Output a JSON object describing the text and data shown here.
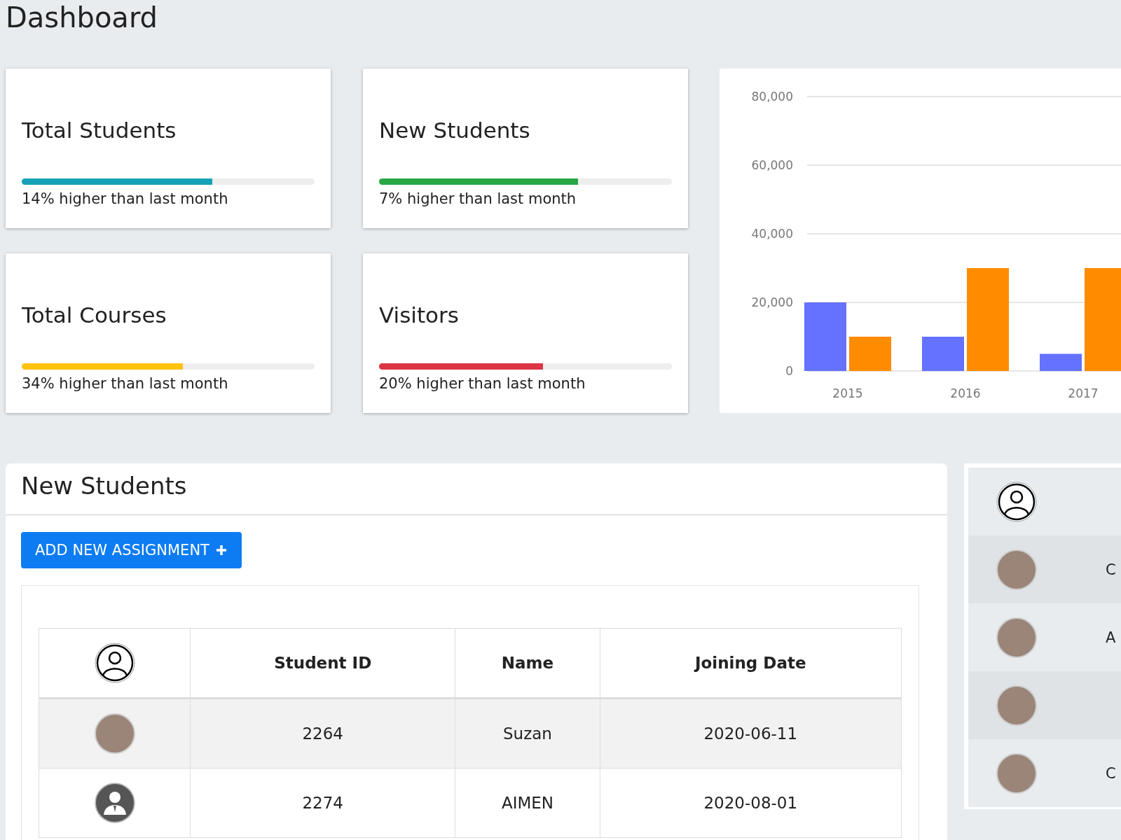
{
  "title": "Dashboard",
  "stat_cards": [
    {
      "title": "Total Students",
      "level": 0.65,
      "color": "#17a2b8",
      "caption": "14% higher than last month"
    },
    {
      "title": "New Students",
      "level": 0.68,
      "color": "#28a745",
      "caption": "7% higher than last month"
    },
    {
      "title": "Total Courses",
      "level": 0.55,
      "color": "#ffc107",
      "caption": "34% higher than last month"
    },
    {
      "title": "Visitors",
      "level": 0.56,
      "color": "#dc3545",
      "caption": "20% higher than last month"
    }
  ],
  "chart": {
    "chart_data": {
      "type": "bar",
      "categories": [
        "2015",
        "2016",
        "2017"
      ],
      "ylim": [
        0,
        80000
      ],
      "grid": true,
      "yticks": [
        {
          "value": 0,
          "label": "0"
        },
        {
          "value": 20000,
          "label": "20,000"
        },
        {
          "value": 40000,
          "label": "40,000"
        },
        {
          "value": 60000,
          "label": "60,000"
        },
        {
          "value": 80000,
          "label": "80,000"
        }
      ],
      "series": [
        {
          "color": "#6571ff",
          "values": [
            20000,
            10000,
            5000
          ]
        },
        {
          "color": "#ff8c00",
          "values": [
            10000,
            30000,
            30000
          ]
        }
      ]
    }
  },
  "new_students": {
    "title": "New Students",
    "add_button": "ADD NEW ASSIGNMENT",
    "table": {
      "columns": [
        "Student ID",
        "Name",
        "Joining Date"
      ],
      "rows": [
        {
          "kind": "photo",
          "cells": [
            "2264",
            "Suzan",
            "2020-06-11"
          ]
        },
        {
          "kind": "silhouette",
          "cells": [
            "2274",
            "AIMEN",
            "2020-08-01"
          ]
        }
      ]
    }
  },
  "side_list": {
    "rows": [
      {
        "kind": "photo",
        "text": "C"
      },
      {
        "kind": "photo",
        "text": "A"
      },
      {
        "kind": "photo"
      },
      {
        "kind": "photo",
        "text": "C"
      }
    ]
  }
}
